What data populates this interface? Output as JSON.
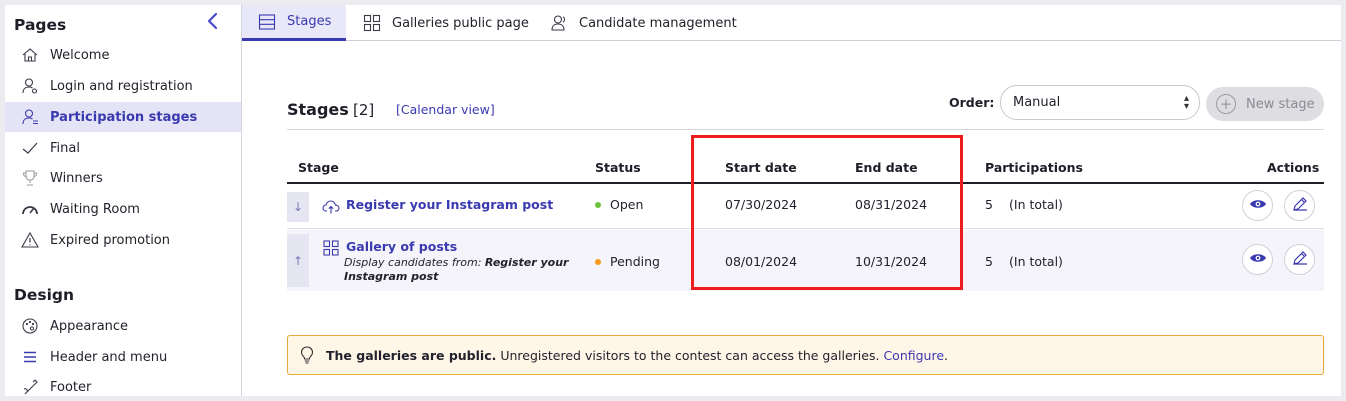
{
  "sidebar": {
    "pages_title": "Pages",
    "collapse_glyph": "‹",
    "items": [
      {
        "label": "Welcome",
        "icon": "home-icon"
      },
      {
        "label": "Login and registration",
        "icon": "user-key-icon"
      },
      {
        "label": "Participation stages",
        "icon": "user-list-icon",
        "active": true
      },
      {
        "label": "Final",
        "icon": "checkmark-icon"
      },
      {
        "label": "Winners",
        "icon": "trophy-icon"
      },
      {
        "label": "Waiting Room",
        "icon": "gauge-icon"
      },
      {
        "label": "Expired promotion",
        "icon": "warning-icon"
      }
    ],
    "design_title": "Design",
    "design_items": [
      {
        "label": "Appearance",
        "icon": "palette-icon"
      },
      {
        "label": "Header and menu",
        "icon": "menu-icon"
      },
      {
        "label": "Footer",
        "icon": "footer-icon"
      }
    ]
  },
  "tabs": [
    {
      "label": "Stages",
      "icon": "stages-list-icon",
      "active": true
    },
    {
      "label": "Galleries public page",
      "icon": "grid-icon"
    },
    {
      "label": "Candidate management",
      "icon": "users-icon"
    }
  ],
  "header": {
    "title": "Stages",
    "count": "[2]",
    "calendar_link": "[Calendar view]",
    "order_label": "Order:",
    "order_value": "Manual",
    "new_stage_label": "New stage"
  },
  "table": {
    "columns": [
      "Stage",
      "Status",
      "Start date",
      "End date",
      "Participations",
      "Actions"
    ],
    "rows": [
      {
        "arrow": "↓",
        "icon": "upload-cloud-icon",
        "name": "Register your Instagram post",
        "status": "Open",
        "status_color": "#6cc23a",
        "start": "07/30/2024",
        "end": "08/31/2024",
        "participations": "5",
        "participations_note": "(In total)"
      },
      {
        "arrow": "↑",
        "icon": "gallery-grid-icon",
        "name": "Gallery of posts",
        "desc_prefix": "Display candidates from: ",
        "desc_bold": "Register your Instagram post",
        "status": "Pending",
        "status_color": "#f59a1e",
        "start": "08/01/2024",
        "end": "10/31/2024",
        "participations": "5",
        "participations_note": "(In total)"
      }
    ]
  },
  "notice": {
    "bold": "The galleries are public.",
    "text": "Unregistered visitors to the contest can access the galleries.",
    "link": "Configure",
    "tail": "."
  },
  "colors": {
    "accent": "#3a3ab0",
    "highlight": "#ee1c1c",
    "notice_border": "#e6a93a",
    "notice_bg": "#fff6e8"
  }
}
